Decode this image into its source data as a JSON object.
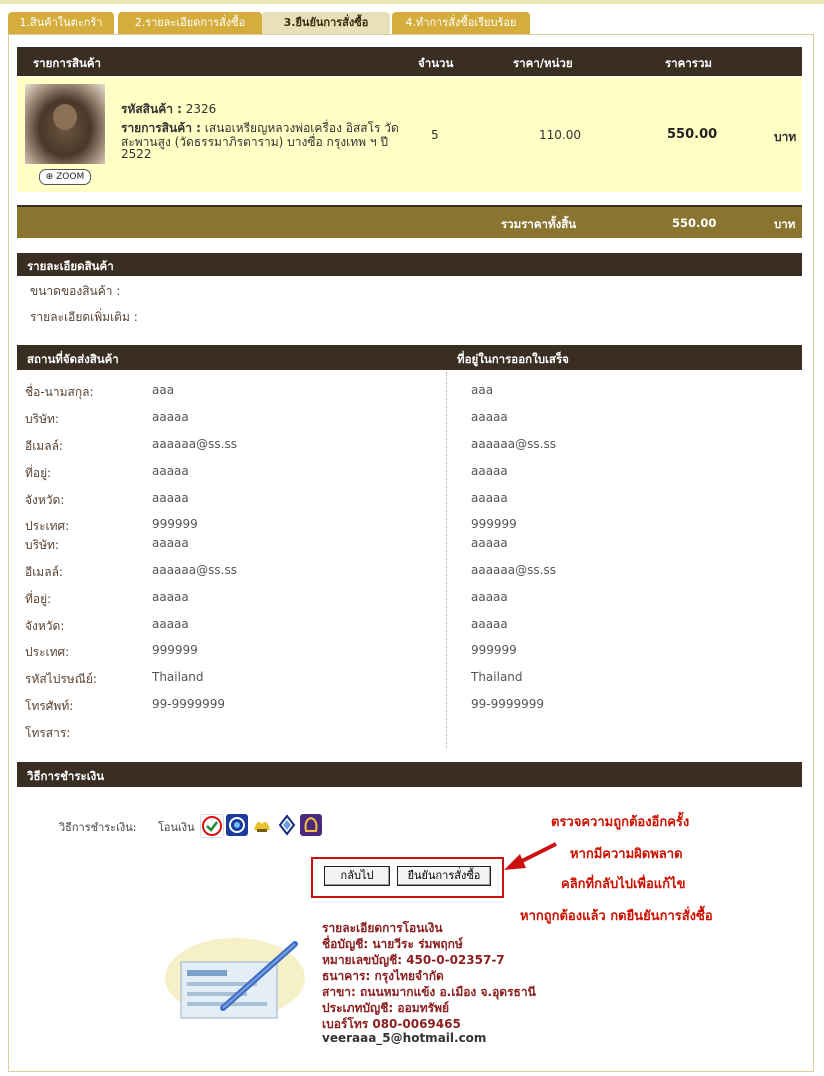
{
  "tabs": [
    {
      "label": "1.สินค้าในตะกร้า"
    },
    {
      "label": "2.รายละเอียดการสั่งซื้อ"
    },
    {
      "label": "3.ยืนยันการสั่งซื้อ"
    },
    {
      "label": "4.ทำการสั่งซื้อเรียบร้อย"
    }
  ],
  "cart": {
    "headers": {
      "item": "รายการสินค้า",
      "qty": "จำนวน",
      "unit_price": "ราคา/หน่วย",
      "total": "ราคารวม"
    },
    "item": {
      "code_label": "รหัสสินค้า :",
      "code": "2326",
      "name_label": "รายการสินค้า :",
      "name_line1": "เสนอเหรียญหลวงพ่อเครื่อง อิสสโร วัด",
      "name_line2": "สะพานสูง (วัดธรรมาภิรตาราม) บางซื่อ กรุงเทพ ฯ ปี",
      "name_line3": "2522",
      "qty": "5",
      "unit_price": "110.00",
      "total": "550.00",
      "currency": "บาท",
      "zoom": "ZOOM"
    },
    "grand_label": "รวมราคาทั้งสิ้น",
    "grand_total": "550.00",
    "grand_currency": "บาท"
  },
  "details": {
    "header": "รายละเอียดสินค้า",
    "size_label": "ขนาดของสินค้า :",
    "more_label": "รายละเอียดเพิ่มเติม :"
  },
  "address": {
    "ship_header": "สถานที่จัดส่งสินค้า",
    "bill_header": "ที่อยู่ในการออกใบเสร็จ",
    "rows": [
      {
        "label": "ชื่อ-นามสกุล:",
        "ship": "aaa",
        "bill": "aaa"
      },
      {
        "label": "บริษัท:",
        "ship": "aaaaa",
        "bill": "aaaaa"
      },
      {
        "label": "อีเมลล์:",
        "ship": "aaaaaa@ss.ss",
        "bill": "aaaaaa@ss.ss"
      },
      {
        "label": "ที่อยู่:",
        "ship": "aaaaa",
        "bill": "aaaaa"
      },
      {
        "label": "จังหวัด:",
        "ship": "aaaaa",
        "bill": "aaaaa"
      },
      {
        "label": "ประเทศ:",
        "ship": "999999",
        "bill": "999999"
      },
      {
        "label": "บริษัท:",
        "ship": "aaaaa",
        "bill": "aaaaa"
      },
      {
        "label": "อีเมลล์:",
        "ship": "aaaaaa@ss.ss",
        "bill": "aaaaaa@ss.ss"
      },
      {
        "label": "ที่อยู่:",
        "ship": "aaaaa",
        "bill": "aaaaa"
      },
      {
        "label": "จังหวัด:",
        "ship": "aaaaa",
        "bill": "aaaaa"
      },
      {
        "label": "ประเทศ:",
        "ship": "999999",
        "bill": "999999"
      },
      {
        "label": "รหัสไปรษณีย์:",
        "ship": "Thailand",
        "bill": "Thailand"
      },
      {
        "label": "โทรศัพท์:",
        "ship": "99-9999999",
        "bill": "99-9999999"
      },
      {
        "label": "โทรสาร:",
        "ship": "",
        "bill": ""
      }
    ]
  },
  "payment": {
    "header": "วิธีการชำระเงิน",
    "label": "วิธีการชำระเงิน:",
    "method": "โอนเงิน",
    "banks": [
      {
        "icon": "kasikorn-bank-icon",
        "color": "#ffffff"
      },
      {
        "icon": "krungthai-bank-icon",
        "color": "#1a3a9c"
      },
      {
        "icon": "krungsri-bank-icon",
        "color": "#e8c22e"
      },
      {
        "icon": "bangkok-bank-icon",
        "color": "#1a2a7c"
      },
      {
        "icon": "scb-bank-icon",
        "color": "#4b2a7b"
      }
    ]
  },
  "buttons": {
    "back": "กลับไป",
    "confirm": "ยืนยันการสั่งซื้อ"
  },
  "notes": [
    "ตรวจความถูกต้องอีกครั้ง",
    "หากมีความผิดพลาด",
    "คลิกที่กลับไปเพื่อแก้ไข",
    "หากถูกต้องแล้ว กดยืนยันการสั่งซื้อ"
  ],
  "transfer": [
    "รายละเอียดการโอนเงิน",
    "ชื่อบัญชี: นายวีระ ร่มพฤกษ์",
    "หมายเลขบัญชี: 450-0-02357-7",
    "ธนาคาร: กรุงไทยจำกัด",
    "สาขา: ถนนหมากแข้ง อ.เมือง จ.อุดรธานี",
    "ประเภทบัญชี: ออมทรัพย์",
    "เบอร์โทร 080-0069465",
    "veeraaa_5@hotmail.com"
  ],
  "colors": {
    "tab": "#d4ad3c",
    "header_bar": "#3a2d22",
    "total_bar": "#8a7530",
    "highlight": "#ffffc6",
    "note": "#cc1100"
  }
}
